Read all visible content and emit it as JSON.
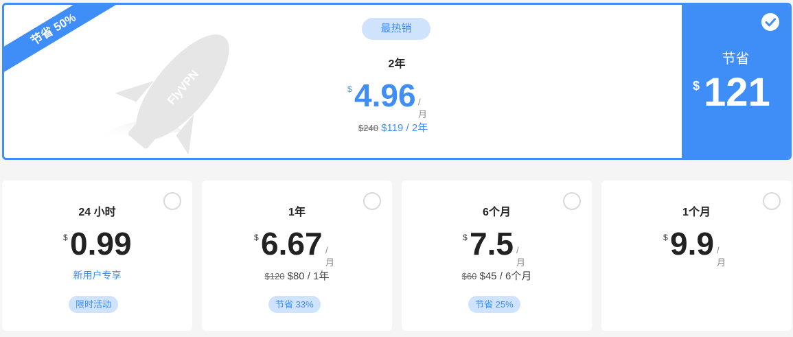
{
  "featured": {
    "ribbon": "节省 50%",
    "rocket_text": "FlyVPN",
    "badge": "最热销",
    "term": "2年",
    "currency": "$",
    "price": "4.96",
    "unit": "/月",
    "original_price": "$240",
    "total": "$119 / 2年",
    "save_label": "节省",
    "save_currency": "$",
    "save_amount": "121",
    "selected": true
  },
  "plans": [
    {
      "term": "24 小时",
      "currency": "$",
      "price": "0.99",
      "unit": "",
      "original_price": "",
      "total": "新用户专享",
      "badge": "限时活动"
    },
    {
      "term": "1年",
      "currency": "$",
      "price": "6.67",
      "unit": "/月",
      "original_price": "$120",
      "total": "$80 / 1年",
      "badge": "节省 33%"
    },
    {
      "term": "6个月",
      "currency": "$",
      "price": "7.5",
      "unit": "/月",
      "original_price": "$60",
      "total": "$45 / 6个月",
      "badge": "节省 25%"
    },
    {
      "term": "1个月",
      "currency": "$",
      "price": "9.9",
      "unit": "/月",
      "original_price": "",
      "total": "",
      "badge": ""
    }
  ],
  "colors": {
    "accent": "#3f8ef7",
    "badge_bg": "#cfe3fd",
    "background": "#f5f5f5"
  },
  "icons": {
    "check": "check-icon",
    "rocket": "rocket-icon"
  }
}
